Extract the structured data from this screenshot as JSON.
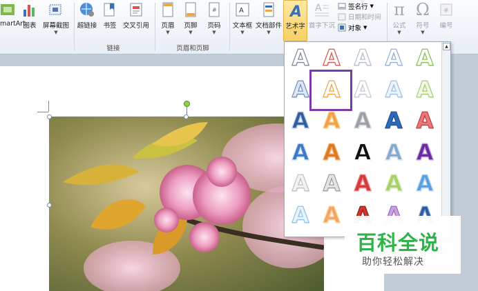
{
  "ribbon": {
    "illustrations": {
      "smartart": "SmartArt",
      "chart": "图表",
      "screenshot": "屏幕截图"
    },
    "links": {
      "hyperlink": "超链接",
      "bookmark": "书签",
      "crossref": "交叉引用",
      "group_label": "链接"
    },
    "header_footer": {
      "header": "页眉",
      "footer": "页脚",
      "page_number": "页码",
      "group_label": "页眉和页脚"
    },
    "text": {
      "textbox": "文本框",
      "quickparts": "文档部件",
      "wordart": "艺术字",
      "dropcap": "首字下沉",
      "signature": "签名行",
      "datetime": "日期和时间",
      "object": "对象"
    },
    "symbols": {
      "equation": "公式",
      "symbol": "符号",
      "numbering": "编号"
    }
  },
  "wordart_gallery": {
    "selected_index": 6,
    "styles": [
      {
        "letter": "A",
        "fill": "#ffffff",
        "stroke": "#7d8a99"
      },
      {
        "letter": "A",
        "fill": "#ffffff",
        "stroke": "#d2584a"
      },
      {
        "letter": "A",
        "fill": "#ffffff",
        "stroke": "#b8bfc8"
      },
      {
        "letter": "A",
        "fill": "#ffffff",
        "stroke": "#8fb2d8"
      },
      {
        "letter": "A",
        "fill": "#ffffff",
        "stroke": "#8cbf4e"
      },
      {
        "letter": "A",
        "fill": "#dfe7f3",
        "stroke": "#6f8fbf"
      },
      {
        "letter": "A",
        "fill": "#ffffff",
        "stroke": "#f0a640"
      },
      {
        "letter": "A",
        "fill": "#ffffff",
        "stroke": "#c8cdd3"
      },
      {
        "letter": "A",
        "fill": "#eef4fb",
        "stroke": "#9cc0e6"
      },
      {
        "letter": "A",
        "fill": "#f1f8e6",
        "stroke": "#a9cf72"
      },
      {
        "letter": "A",
        "fill": "#2f5f9e",
        "stroke": "#b7c9e4"
      },
      {
        "letter": "A",
        "fill": "#f4a04a",
        "stroke": "#f7d58c"
      },
      {
        "letter": "A",
        "fill": "#9aa0a6",
        "stroke": "#d5d8dc"
      },
      {
        "letter": "A",
        "fill": "#2d6bbf",
        "stroke": "#1f4f8f"
      },
      {
        "letter": "A",
        "fill": "#e8797b",
        "stroke": "#c43c3c"
      },
      {
        "letter": "A",
        "fill": "#3d78c4",
        "stroke": "#c5d7ee"
      },
      {
        "letter": "A",
        "fill": "#e07a22",
        "stroke": "#f0b47a"
      },
      {
        "letter": "A",
        "fill": "#111111",
        "stroke": "#ffffff"
      },
      {
        "letter": "A",
        "fill": "#8aa9c9",
        "stroke": "#dbe6f1"
      },
      {
        "letter": "A",
        "fill": "#6a2aa0",
        "stroke": "#b9a2d6"
      },
      {
        "letter": "A",
        "fill": "#f2f2f2",
        "stroke": "#c3c3c3"
      },
      {
        "letter": "A",
        "fill": "#e4e4e4",
        "stroke": "#9aa0a6"
      },
      {
        "letter": "A",
        "fill": "#d53a3a",
        "stroke": "#f08b8b"
      },
      {
        "letter": "A",
        "fill": "#a7d06a",
        "stroke": "#d9ecb9"
      },
      {
        "letter": "A",
        "fill": "#5aa0dd",
        "stroke": "#bcdcf6"
      },
      {
        "letter": "A",
        "fill": "#e8f4fb",
        "stroke": "#8dc6ea"
      },
      {
        "letter": "A",
        "fill": "#f5a65c",
        "stroke": "#fbd3ab"
      },
      {
        "letter": "A",
        "fill": "#d0342c",
        "stroke": "#8c1d18"
      },
      {
        "letter": "A",
        "fill": "#c9a3e0",
        "stroke": "#9b6bbf"
      },
      {
        "letter": "A",
        "fill": "#2c5d9f",
        "stroke": "#8fb0da"
      }
    ]
  },
  "watermark": {
    "title": "百科全说",
    "subtitle": "助你轻松解决"
  },
  "colors": {
    "accent_selection": "#7b3aa8",
    "wordart_active": "#f8cf62",
    "watermark_green": "#2fb24a"
  }
}
